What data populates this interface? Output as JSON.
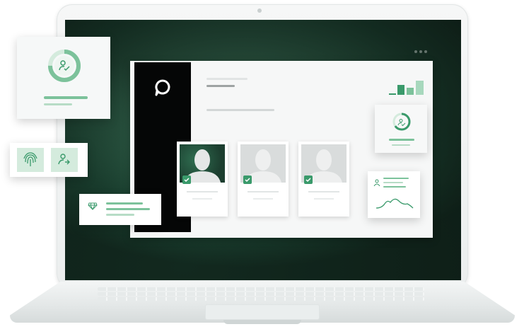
{
  "accent_color": "#3a9a6b",
  "accent_light": "#9fd1b5",
  "screen_dark": "#12291f",
  "icons": {
    "app_logo": "chat-bubble-icon",
    "user": "user-check-icon",
    "fingerprint": "fingerprint-icon",
    "user_arrow": "user-arrow-icon",
    "gem": "gem-icon",
    "check": "check-icon",
    "chart": "line-chart-icon"
  },
  "profile_cards": [
    {
      "state": "selected"
    },
    {
      "state": "default"
    },
    {
      "state": "default"
    }
  ],
  "big_card_progress_percent": 75,
  "small_card_progress_percent": 65
}
